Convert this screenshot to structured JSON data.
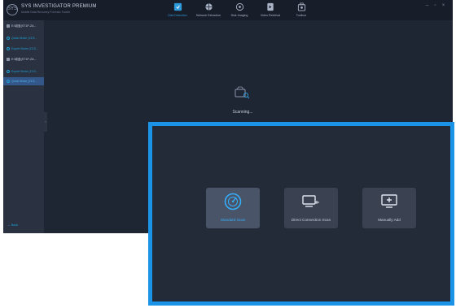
{
  "app": {
    "logo_text": "SYS",
    "brand_name": "SYS INVESTIGATOR PREMIUM",
    "brand_sub": "Mobile Data Recovery Forensic Toolkit"
  },
  "nav": {
    "items": [
      {
        "label": "Disk Detection",
        "icon": "disk-detection-icon",
        "active": true
      },
      {
        "label": "Network Extraction",
        "icon": "globe-icon",
        "active": false
      },
      {
        "label": "Disk Imaging",
        "icon": "disk-imaging-icon",
        "active": false
      },
      {
        "label": "Video Retrieval",
        "icon": "video-retrieval-icon",
        "active": false
      },
      {
        "label": "Toolbox",
        "icon": "toolbox-icon",
        "active": false
      }
    ]
  },
  "window_controls": {
    "minimize": "–",
    "maximize": "▫",
    "close": "×"
  },
  "sidebar": {
    "rows": [
      {
        "type": "disk",
        "text": "E:\\磁盘(ST1P-ZA..."
      },
      {
        "type": "mode",
        "text": "Quick Mode (13.5..."
      },
      {
        "type": "mode",
        "text": "Expert Mode (13.5..."
      },
      {
        "type": "disk",
        "text": "E:\\磁盘(ST1P-ZA..."
      },
      {
        "type": "mode",
        "text": "Expert Mode (13.5..."
      },
      {
        "type": "mode",
        "text": "Quick Mode (13.5...",
        "selected": true
      }
    ],
    "back_label": "← Back",
    "collapse_glyph": "‹"
  },
  "scan": {
    "status": "Scanning..."
  },
  "zoom_panel": {
    "cards": [
      {
        "label": "Standard Scan",
        "icon": "radar-scan-icon",
        "primary": true
      },
      {
        "label": "Direct Connection Scan",
        "icon": "monitor-cable-icon",
        "primary": false
      },
      {
        "label": "Manually Add",
        "icon": "monitor-add-icon",
        "primary": false
      }
    ]
  },
  "colors": {
    "accent": "#1b94e8",
    "window_bg": "#1f2633",
    "sidebar_bg": "#2a3241",
    "selected_row": "#34578a",
    "card_bg": "#3a4252"
  }
}
